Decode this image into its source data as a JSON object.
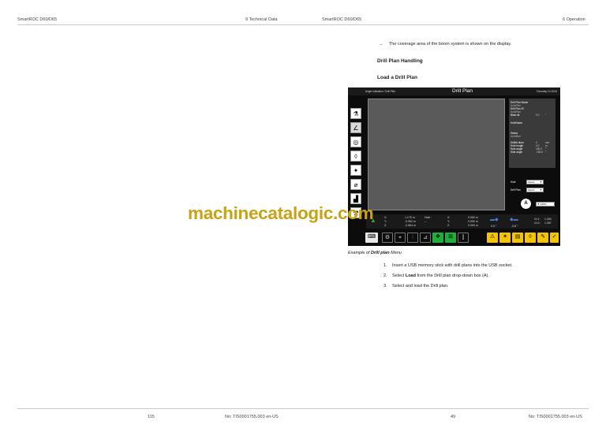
{
  "header": {
    "left_title": "SmartROC D60/D65",
    "left_section": "9 Technical Data",
    "right_title": "SmartROC D60/D65",
    "right_section": "6 Operation"
  },
  "content": {
    "result_text": "The coverage area of the boom system is shown on the display.",
    "heading1": "Drill Plan Handling",
    "heading2": "Load a Drill Plan"
  },
  "display": {
    "top_left": "Angle Indication / Drill Plan",
    "title": "Drill Plan",
    "datetime": "Thursday 11:18:44",
    "panel": {
      "drill_plan_name_label": "Drill Plan Name",
      "drill_plan_name_value": "AutoPlan",
      "drill_plan_id_label": "Drill Plan ID",
      "drill_plan_id_value": "AutoPlan",
      "blast_dir_label": "Blast dir.",
      "blast_dir_value": "0.0",
      "blast_dir_unit": "°",
      "holename_label": "HoleName",
      "status_label": "Status",
      "status_value": "Undrilled",
      "drillbit_label": "Drillbit diam.",
      "drillbit_value": "0",
      "drillbit_unit": "mm",
      "hole_length_label": "Hole length",
      "hole_length_value": "0.0",
      "hole_length_unit": "m",
      "hole_angle_label": "Hole angle",
      "hole_angle_value": "180.0",
      "hole_angle_unit": "°",
      "side_angle_label": "Side angle",
      "side_angle_value": "-180.0",
      "side_angle_unit": "°"
    },
    "hole_label": "Hole",
    "hole_select": "Select...",
    "drillplan_label": "Drill Plan",
    "drillplan_select": "Select...",
    "zoom_value": "100%",
    "callout": "A",
    "status": {
      "x_label": "X:",
      "x_value": "1.175 m",
      "y_label": "Y:",
      "y_value": "-0.052 m",
      "z_label": "Z:",
      "z_value": "-2.564 m",
      "hole_label": "Hole :",
      "hole_value": "--",
      "x2_label": "X:",
      "x2_value": "0.000 m",
      "y2_label": "Y:",
      "y2_value": "0.000 m",
      "z2_label": "Z:",
      "z2_value": "0.000 m",
      "angle1": "0.5 °",
      "angle2": "-0.8 °",
      "gr1_label": "Gr.1:",
      "gr1_value": "1.264",
      "gr2_label": "Gr.2:",
      "gr2_value": "1.287"
    }
  },
  "caption": {
    "prefix": "Example of ",
    "bold": "Drill plan",
    "suffix": " Menu"
  },
  "steps": [
    {
      "num": "1.",
      "text": "Insert a USB memory stick with drill plans into the USB socket."
    },
    {
      "num": "2.",
      "pre": "Select ",
      "bold": "Load",
      "post": " from the Drill plan drop-down box (A)."
    },
    {
      "num": "3.",
      "text": "Select and load the Drill plan."
    }
  ],
  "footer": {
    "left_page": "115",
    "left_doc": "No: TIS0001755.003 en-US",
    "right_page": "49",
    "right_doc": "No: TIS0001755.003 en-US"
  },
  "watermark": "machinecatalogic.com",
  "colors": {
    "watermark": "#c8a214",
    "toolbar_yellow": "#f2c500",
    "toolbar_green": "#1fae3a",
    "map_gray": "#5a5a5a"
  }
}
